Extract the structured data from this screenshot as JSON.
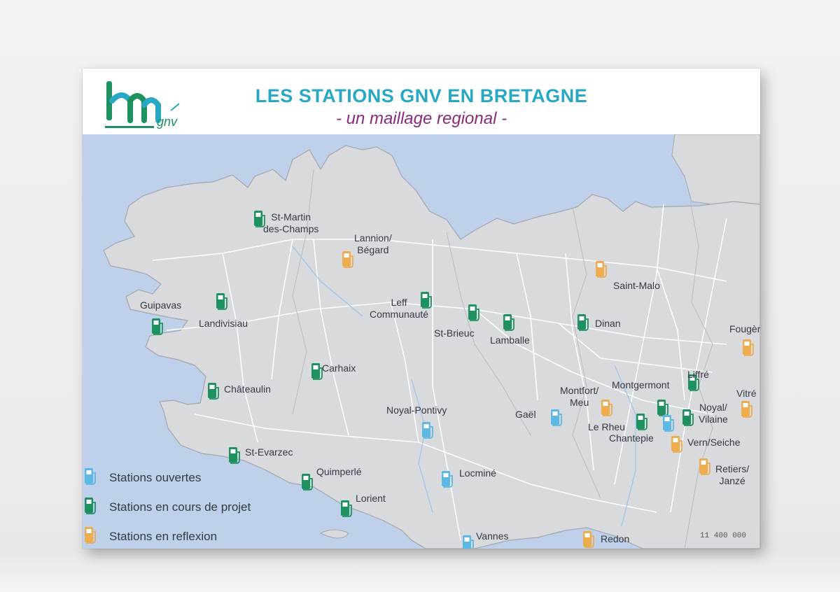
{
  "header": {
    "logo_text": "bm",
    "logo_subtext": "gnv",
    "title": "LES STATIONS GNV EN BRETAGNE",
    "subtitle": "- un maillage regional -"
  },
  "colors": {
    "sea": "#bfd0ea",
    "land": "#d9dadd",
    "border": "#a3a6ab",
    "road": "#ffffff",
    "open": "#5cb8e4",
    "project": "#1e9160",
    "reflexion": "#eeac4d",
    "title": "#27a9c6",
    "subtitle": "#8b2a7e"
  },
  "legend": [
    {
      "label": "Stations ouvertes",
      "status": "open"
    },
    {
      "label": "Stations en cours de projet",
      "status": "project"
    },
    {
      "label": "Stations en reflexion",
      "status": "reflexion"
    }
  ],
  "scale_text": "11 400 000",
  "stations": [
    {
      "name": "Lannion/\nBégard",
      "status": "reflexion"
    },
    {
      "name": "St-Martin\ndes-Champs",
      "status": "project"
    },
    {
      "name": "Guipavas",
      "status": "project"
    },
    {
      "name": "Landivisiau",
      "status": "project"
    },
    {
      "name": "Leff\nCommunauté",
      "status": "project"
    },
    {
      "name": "St-Brieuc",
      "status": "project"
    },
    {
      "name": "Lamballe",
      "status": "project"
    },
    {
      "name": "Dinan",
      "status": "project"
    },
    {
      "name": "Saint-Malo",
      "status": "reflexion"
    },
    {
      "name": "Fougères",
      "status": "reflexion"
    },
    {
      "name": "Carhaix",
      "status": "project"
    },
    {
      "name": "Châteaulin",
      "status": "project"
    },
    {
      "name": "Liffré",
      "status": "project"
    },
    {
      "name": "Montgermont",
      "status": "project"
    },
    {
      "name": "Montfort/\nMeu",
      "status": "reflexion"
    },
    {
      "name": "Gaël",
      "status": "open"
    },
    {
      "name": "Noyal-Pontivy",
      "status": "open"
    },
    {
      "name": "Vitré",
      "status": "reflexion"
    },
    {
      "name": "Noyal/\nVilaine",
      "status": "project"
    },
    {
      "name": "Le Rheu",
      "status": "project"
    },
    {
      "name": "Chantepie",
      "status": "open"
    },
    {
      "name": "Vern/Seiche",
      "status": "reflexion"
    },
    {
      "name": "St-Evarzec",
      "status": "project"
    },
    {
      "name": "Quimperlé",
      "status": "project"
    },
    {
      "name": "Locminé",
      "status": "open"
    },
    {
      "name": "Retiers/\nJanzé",
      "status": "reflexion"
    },
    {
      "name": "Lorient",
      "status": "project"
    },
    {
      "name": "Vannes",
      "status": "open"
    },
    {
      "name": "Redon",
      "status": "reflexion"
    }
  ]
}
